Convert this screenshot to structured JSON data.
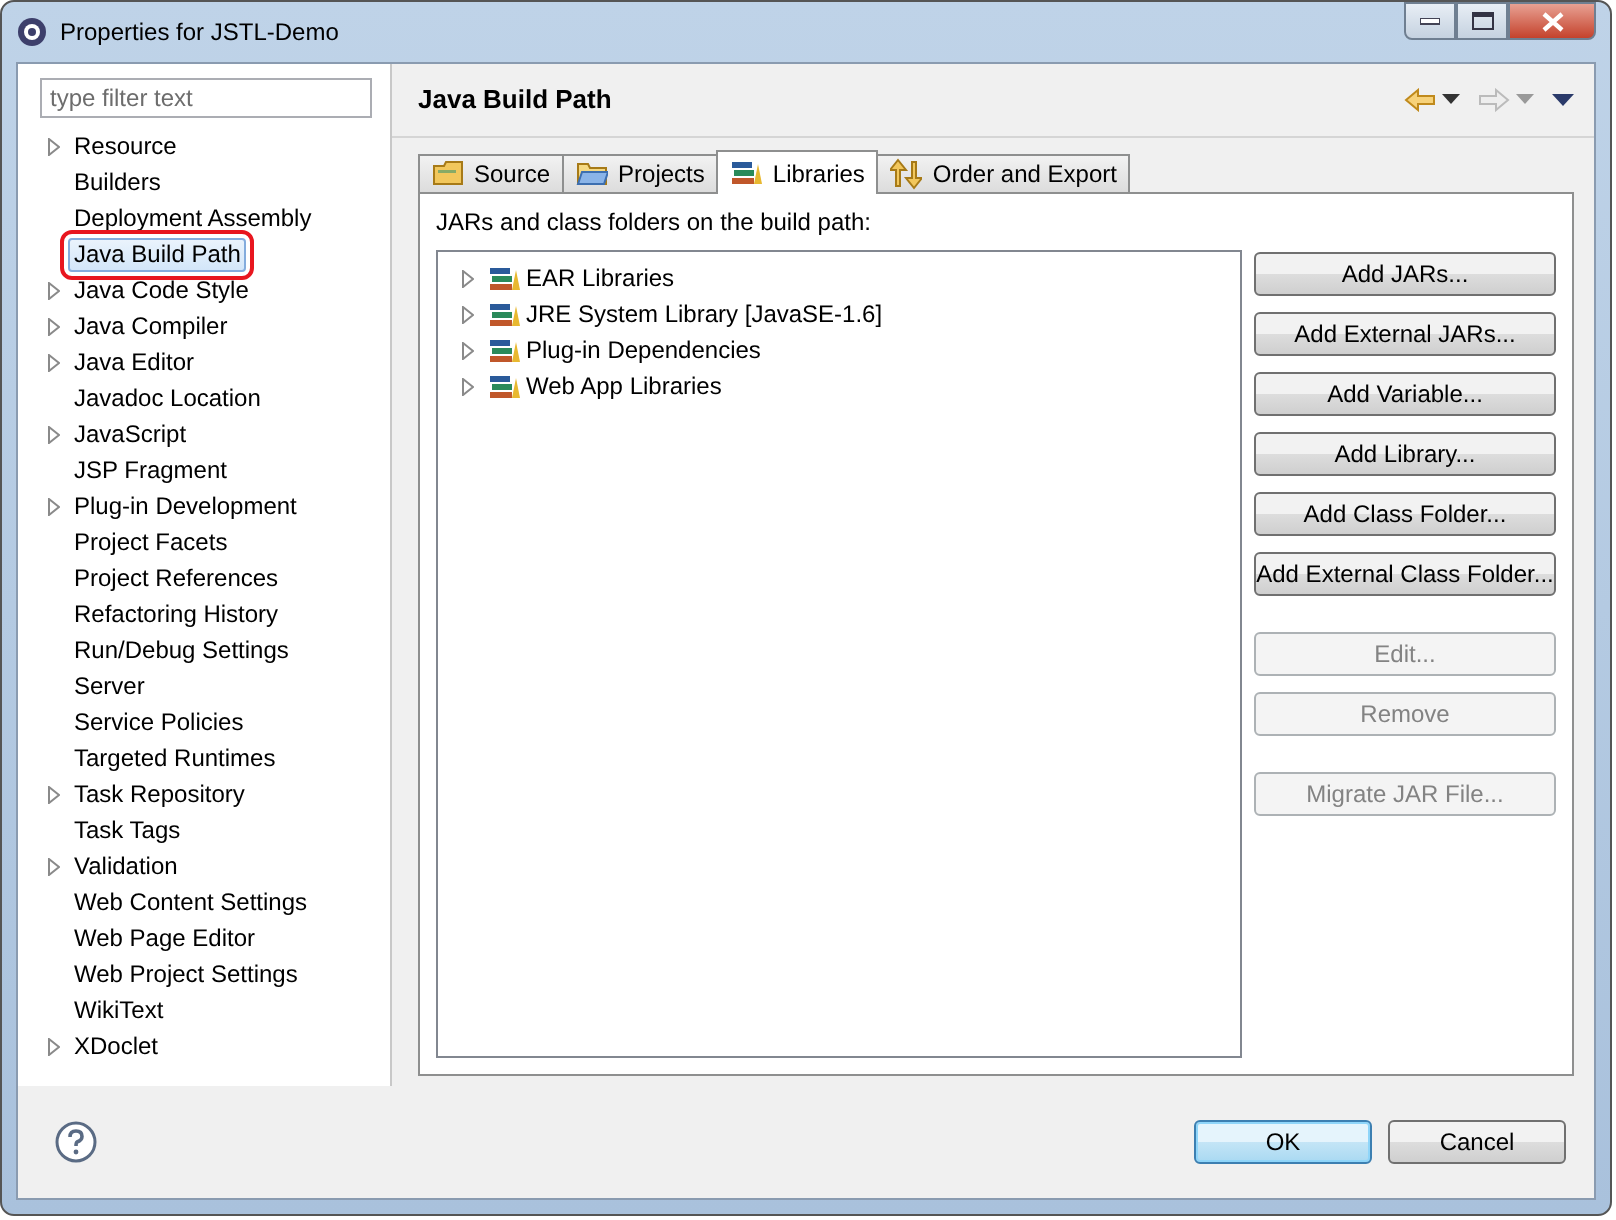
{
  "window": {
    "title": "Properties for JSTL-Demo"
  },
  "filter": {
    "placeholder": "type filter text"
  },
  "sidebar": {
    "items": [
      {
        "label": "Resource",
        "expandable": true,
        "selected": false
      },
      {
        "label": "Builders",
        "expandable": false,
        "selected": false
      },
      {
        "label": "Deployment Assembly",
        "expandable": false,
        "selected": false
      },
      {
        "label": "Java Build Path",
        "expandable": false,
        "selected": true
      },
      {
        "label": "Java Code Style",
        "expandable": true,
        "selected": false
      },
      {
        "label": "Java Compiler",
        "expandable": true,
        "selected": false
      },
      {
        "label": "Java Editor",
        "expandable": true,
        "selected": false
      },
      {
        "label": "Javadoc Location",
        "expandable": false,
        "selected": false
      },
      {
        "label": "JavaScript",
        "expandable": true,
        "selected": false
      },
      {
        "label": "JSP Fragment",
        "expandable": false,
        "selected": false
      },
      {
        "label": "Plug-in Development",
        "expandable": true,
        "selected": false
      },
      {
        "label": "Project Facets",
        "expandable": false,
        "selected": false
      },
      {
        "label": "Project References",
        "expandable": false,
        "selected": false
      },
      {
        "label": "Refactoring History",
        "expandable": false,
        "selected": false
      },
      {
        "label": "Run/Debug Settings",
        "expandable": false,
        "selected": false
      },
      {
        "label": "Server",
        "expandable": false,
        "selected": false
      },
      {
        "label": "Service Policies",
        "expandable": false,
        "selected": false
      },
      {
        "label": "Targeted Runtimes",
        "expandable": false,
        "selected": false
      },
      {
        "label": "Task Repository",
        "expandable": true,
        "selected": false
      },
      {
        "label": "Task Tags",
        "expandable": false,
        "selected": false
      },
      {
        "label": "Validation",
        "expandable": true,
        "selected": false
      },
      {
        "label": "Web Content Settings",
        "expandable": false,
        "selected": false
      },
      {
        "label": "Web Page Editor",
        "expandable": false,
        "selected": false
      },
      {
        "label": "Web Project Settings",
        "expandable": false,
        "selected": false
      },
      {
        "label": "WikiText",
        "expandable": false,
        "selected": false
      },
      {
        "label": "XDoclet",
        "expandable": true,
        "selected": false
      }
    ]
  },
  "page": {
    "title": "Java Build Path"
  },
  "tabs": [
    {
      "label": "Source",
      "kind": "source",
      "selected": false
    },
    {
      "label": "Projects",
      "kind": "projects",
      "selected": false
    },
    {
      "label": "Libraries",
      "kind": "libraries",
      "selected": true
    },
    {
      "label": "Order and Export",
      "kind": "order",
      "selected": false
    }
  ],
  "libraries": {
    "label": "JARs and class folders on the build path:",
    "items": [
      {
        "label": "EAR Libraries",
        "expandable": true
      },
      {
        "label": "JRE System Library [JavaSE-1.6]",
        "expandable": true
      },
      {
        "label": "Plug-in Dependencies",
        "expandable": true
      },
      {
        "label": "Web App Libraries",
        "expandable": true
      }
    ]
  },
  "button_groups": [
    {
      "buttons": [
        {
          "label": "Add JARs...",
          "disabled": false
        },
        {
          "label": "Add External JARs...",
          "disabled": false
        },
        {
          "label": "Add Variable...",
          "disabled": false
        },
        {
          "label": "Add Library...",
          "disabled": false
        },
        {
          "label": "Add Class Folder...",
          "disabled": false
        },
        {
          "label": "Add External Class Folder...",
          "disabled": false
        }
      ]
    },
    {
      "buttons": [
        {
          "label": "Edit...",
          "disabled": true
        },
        {
          "label": "Remove",
          "disabled": true
        }
      ]
    },
    {
      "buttons": [
        {
          "label": "Migrate JAR File...",
          "disabled": true
        }
      ]
    }
  ],
  "footer": {
    "buttons": [
      {
        "label": "OK",
        "default": true
      },
      {
        "label": "Cancel",
        "default": false
      }
    ]
  }
}
